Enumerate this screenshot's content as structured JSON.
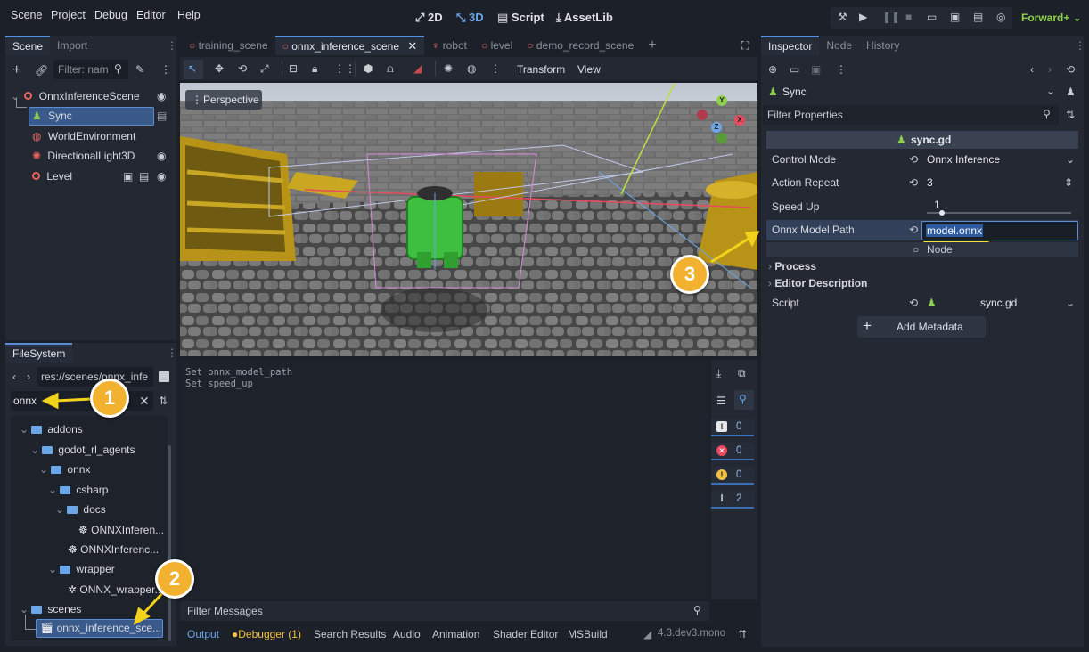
{
  "menu": [
    "Scene",
    "Project",
    "Debug",
    "Editor",
    "Help"
  ],
  "workspaces": [
    {
      "label": "2D",
      "icon": "2d-icon",
      "active": false
    },
    {
      "label": "3D",
      "icon": "3d-icon",
      "active": true
    },
    {
      "label": "Script",
      "icon": "script-icon",
      "active": false
    },
    {
      "label": "AssetLib",
      "icon": "assetlib-icon",
      "active": false
    }
  ],
  "renderer": "Forward+ ⌄",
  "scene_dock": {
    "tabs": [
      "Scene",
      "Import"
    ],
    "filter_placeholder": "Filter: nam",
    "nodes": [
      {
        "label": "OnnxInferenceScene"
      },
      {
        "label": "Sync"
      },
      {
        "label": "WorldEnvironment"
      },
      {
        "label": "DirectionalLight3D"
      },
      {
        "label": "Level"
      }
    ]
  },
  "filesystem": {
    "tab": "FileSystem",
    "path": "res://scenes/onnx_infe",
    "search_value": "onnx",
    "tree": [
      {
        "label": "addons"
      },
      {
        "label": "godot_rl_agents"
      },
      {
        "label": "onnx"
      },
      {
        "label": "csharp"
      },
      {
        "label": "docs"
      },
      {
        "label": "ONNXInferen..."
      },
      {
        "label": "ONNXInferenc..."
      },
      {
        "label": "wrapper"
      },
      {
        "label": "ONNX_wrapper..."
      },
      {
        "label": "scenes"
      },
      {
        "label": "onnx_inference_sce..."
      }
    ]
  },
  "editor_tabs": [
    {
      "label": "training_scene"
    },
    {
      "label": "onnx_inference_scene"
    },
    {
      "label": "robot"
    },
    {
      "label": "level"
    },
    {
      "label": "demo_record_scene"
    }
  ],
  "viewport": {
    "toolbar_menus": [
      "Transform",
      "View"
    ],
    "perspective_label": "Perspective"
  },
  "output": {
    "lines": [
      "Set onnx_model_path",
      "Set speed_up"
    ],
    "filter_placeholder": "Filter Messages",
    "counters": [
      {
        "icon": "message-icon",
        "value": "0",
        "color": "#e6e6e6"
      },
      {
        "icon": "error-icon",
        "value": "0",
        "color": "#e84a5f"
      },
      {
        "icon": "warning-icon",
        "value": "0",
        "color": "#f2c040"
      },
      {
        "icon": "info-icon",
        "value": "2",
        "color": "#e6e6e6"
      }
    ]
  },
  "bottom_tabs": [
    "Output",
    "Debugger (1)",
    "Search Results",
    "Audio",
    "Animation",
    "Shader Editor",
    "MSBuild"
  ],
  "version": "4.3.dev3.mono",
  "inspector": {
    "tabs": [
      "Inspector",
      "Node",
      "History"
    ],
    "object_name": "Sync",
    "filter_placeholder": "Filter Properties",
    "script_header": "sync.gd",
    "properties": [
      {
        "label": "Control Mode",
        "value": "Onnx Inference"
      },
      {
        "label": "Action Repeat",
        "value": "3"
      },
      {
        "label": "Speed Up",
        "value": "1"
      },
      {
        "label": "Onnx Model Path",
        "value": "model.onnx"
      }
    ],
    "node_section": "Node",
    "sections": [
      "Process",
      "Editor Description"
    ],
    "script_label": "Script",
    "script_value": "sync.gd",
    "add_metadata": "Add Metadata"
  },
  "callouts": [
    "1",
    "2",
    "3"
  ],
  "colors": {
    "accent": "#5a8fd6",
    "callout": "#f2b230",
    "selection": "#3a5a8c",
    "node_red": "#e8645a",
    "robot_green": "#3fbf3f"
  }
}
